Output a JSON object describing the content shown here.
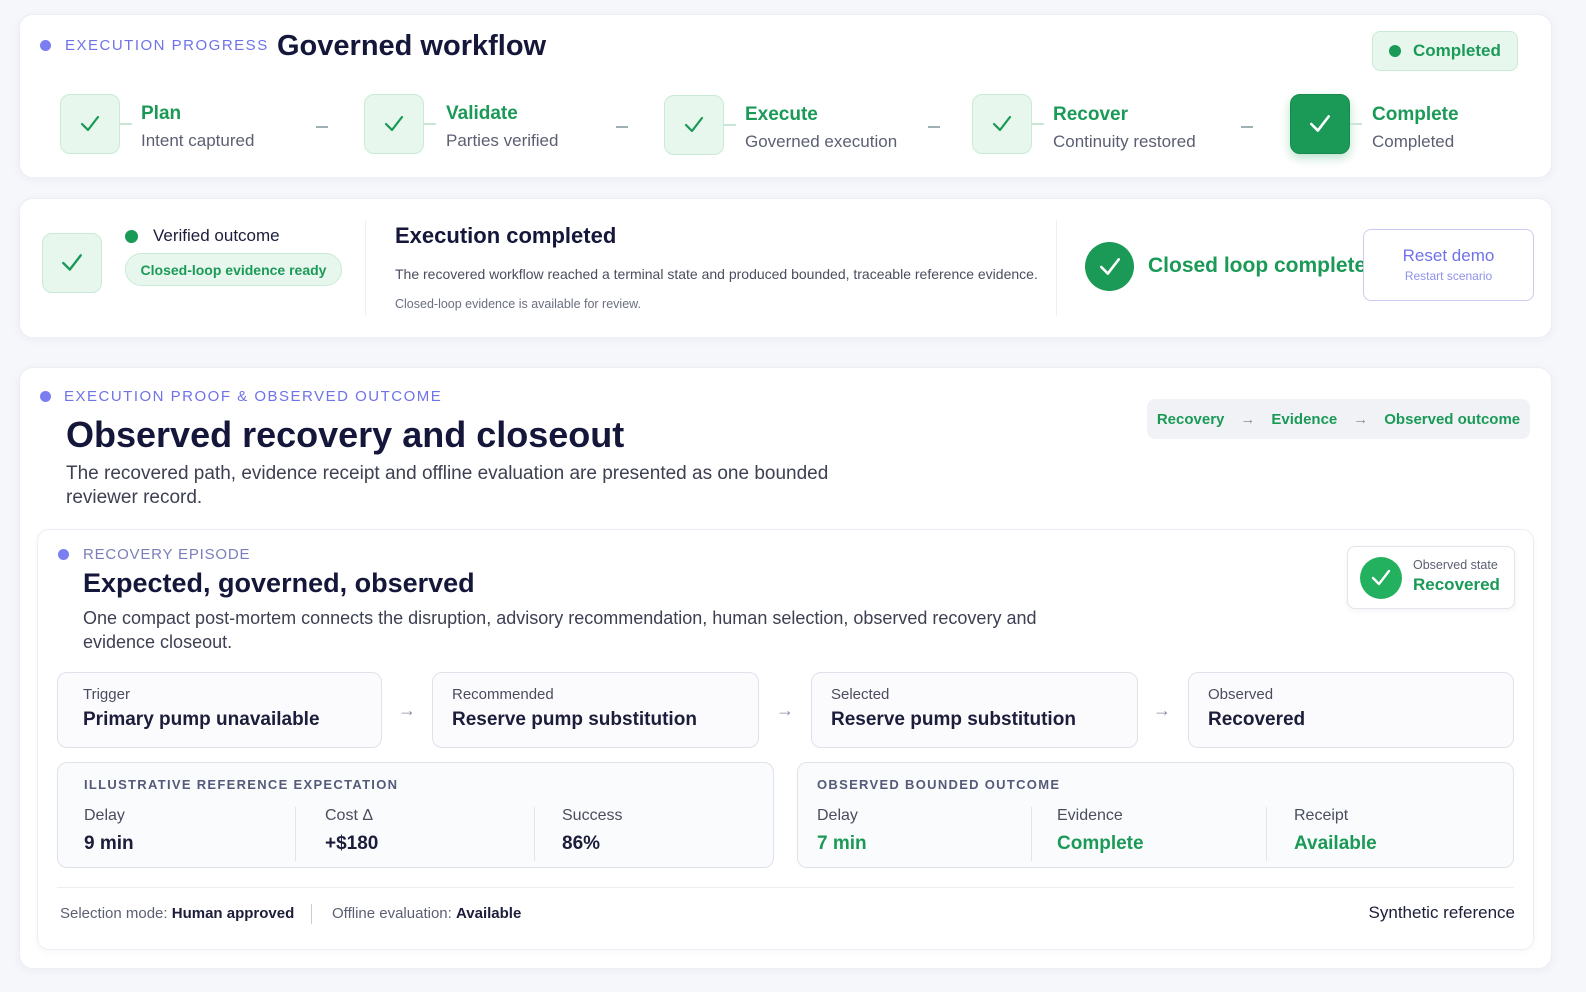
{
  "progress": {
    "eyebrow": "EXECUTION PROGRESS",
    "title": "Governed workflow",
    "status": "Completed",
    "steps": [
      {
        "title": "Plan",
        "subtitle": "Intent captured"
      },
      {
        "title": "Validate",
        "subtitle": "Parties verified"
      },
      {
        "title": "Execute",
        "subtitle": "Governed execution"
      },
      {
        "title": "Recover",
        "subtitle": "Continuity restored"
      },
      {
        "title": "Complete",
        "subtitle": "Completed"
      }
    ]
  },
  "summary": {
    "verified_label": "Verified outcome",
    "evidence_badge": "Closed-loop evidence ready",
    "heading": "Execution completed",
    "description": "The recovered workflow reached a terminal state and produced bounded, traceable reference evidence.",
    "note": "Closed-loop evidence is available for review.",
    "closed_loop": "Closed loop complete",
    "reset_label": "Reset demo",
    "reset_sub": "Restart scenario"
  },
  "proof": {
    "eyebrow": "EXECUTION PROOF & OBSERVED OUTCOME",
    "title": "Observed recovery and closeout",
    "description": "The recovered path, evidence receipt and offline evaluation are presented as one bounded reviewer record.",
    "chain": [
      "Recovery",
      "Evidence",
      "Observed outcome"
    ],
    "chain_arrow": "→"
  },
  "episode": {
    "eyebrow": "RECOVERY EPISODE",
    "title": "Expected, governed, observed",
    "description": "One compact post-mortem connects the disruption, advisory recommendation, human selection, observed recovery and evidence closeout.",
    "state_label": "Observed state",
    "state_value": "Recovered",
    "flow": [
      {
        "label": "Trigger",
        "value": "Primary pump unavailable"
      },
      {
        "label": "Recommended",
        "value": "Reserve pump substitution"
      },
      {
        "label": "Selected",
        "value": "Reserve pump substitution"
      },
      {
        "label": "Observed",
        "value": "Recovered"
      }
    ],
    "arrow": "→",
    "expectation": {
      "heading": "ILLUSTRATIVE REFERENCE EXPECTATION",
      "metrics": [
        {
          "label": "Delay",
          "value": "9 min"
        },
        {
          "label": "Cost Δ",
          "value": "+$180"
        },
        {
          "label": "Success",
          "value": "86%"
        }
      ]
    },
    "observed": {
      "heading": "OBSERVED BOUNDED OUTCOME",
      "metrics": [
        {
          "label": "Delay",
          "value": "7 min"
        },
        {
          "label": "Evidence",
          "value": "Complete"
        },
        {
          "label": "Receipt",
          "value": "Available"
        }
      ]
    },
    "footer": {
      "selection_label": "Selection mode:",
      "selection_value": "Human approved",
      "offline_label": "Offline evaluation:",
      "offline_value": "Available",
      "synthetic": "Synthetic reference"
    }
  },
  "colors": {
    "accent_purple": "#6f72e8",
    "success_green": "#1b9a57",
    "success_bg": "#e8f7ee"
  }
}
